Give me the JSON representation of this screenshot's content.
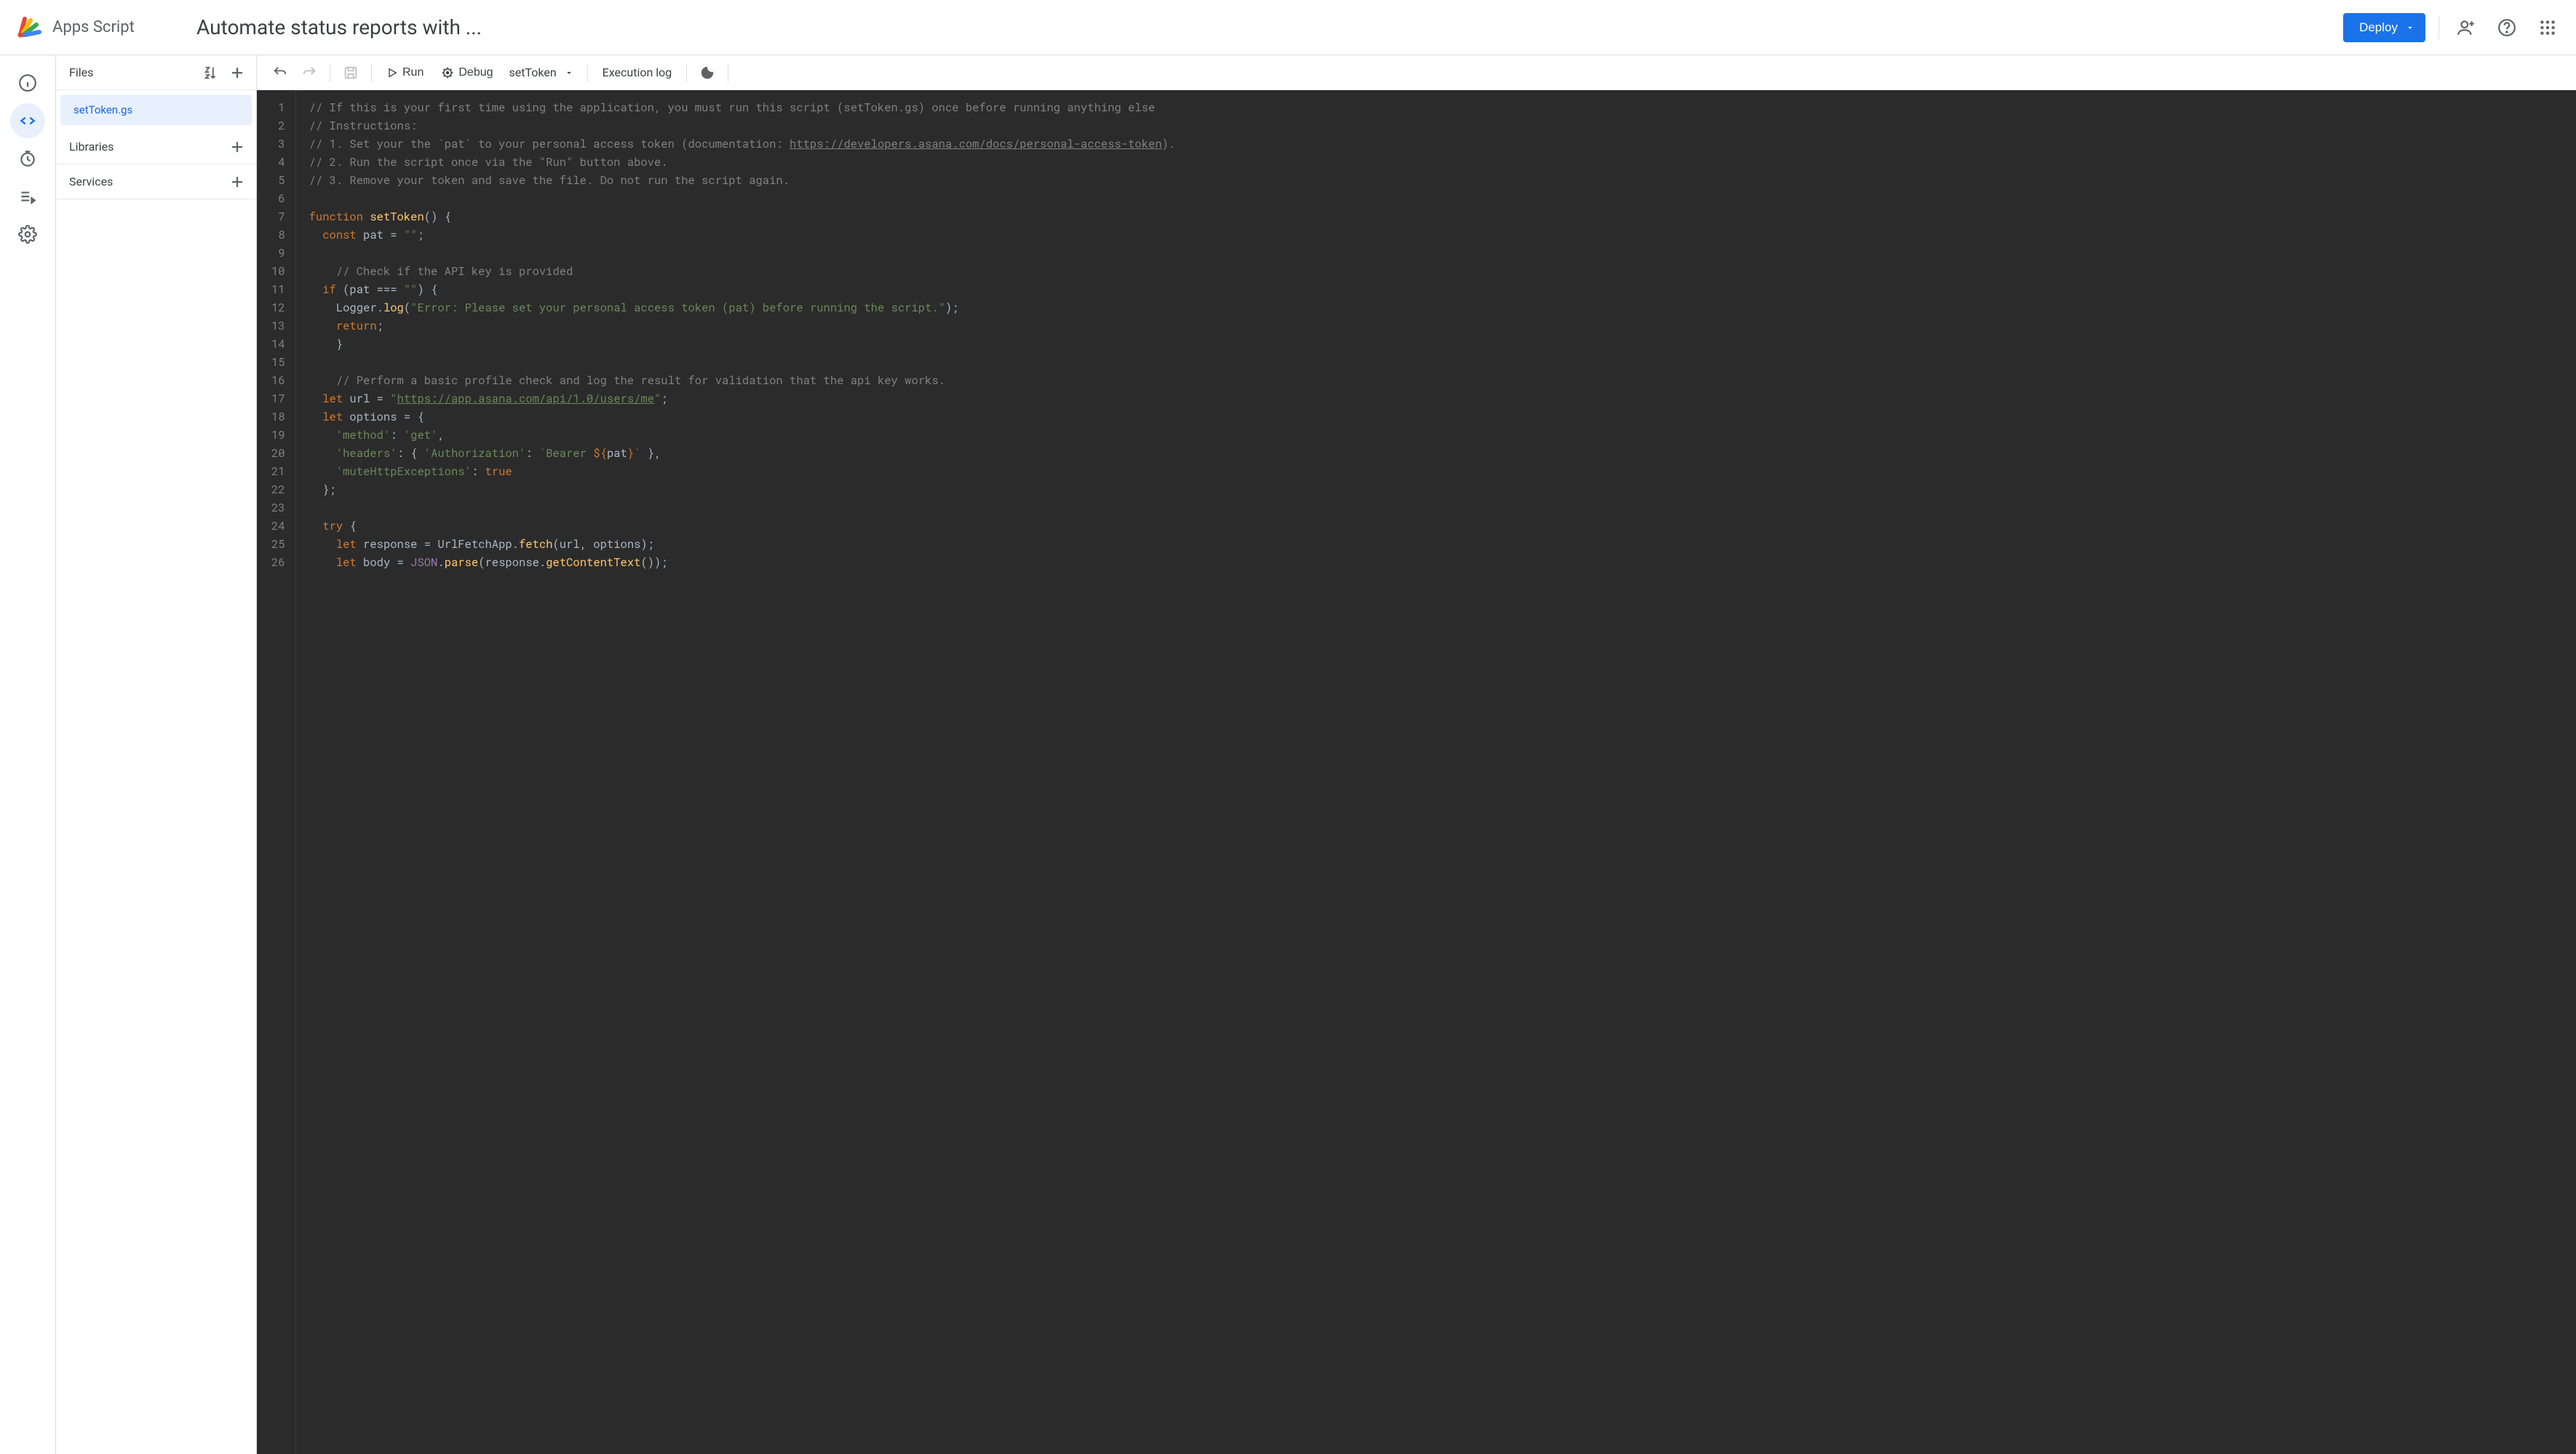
{
  "header": {
    "product_name": "Apps Script",
    "project_title": "Automate status reports with ...",
    "deploy_label": "Deploy"
  },
  "nav": {
    "items": [
      "overview",
      "editor",
      "triggers",
      "executions",
      "settings"
    ],
    "active_index": 1
  },
  "file_panel": {
    "files_label": "Files",
    "libraries_label": "Libraries",
    "services_label": "Services",
    "files": [
      {
        "name": "setToken.gs",
        "selected": true
      }
    ]
  },
  "toolbar": {
    "run_label": "Run",
    "debug_label": "Debug",
    "function_selected": "setToken",
    "exec_log_label": "Execution log"
  },
  "code": {
    "url_doc": "https://developers.asana.com/docs/personal-access-token",
    "api_url": "https://app.asana.com/api/1.0/users/me",
    "lines": [
      {
        "n": 1,
        "type": "comment",
        "text": "// If this is your first time using the application, you must run this script (setToken.gs) once before running anything else"
      },
      {
        "n": 2,
        "type": "comment",
        "text": "// Instructions:"
      },
      {
        "n": 3,
        "type": "comment-url",
        "prefix": "// 1. Set your the `pat` to your personal access token (documentation: ",
        "url": "https://developers.asana.com/docs/personal-access-token",
        "suffix": ")."
      },
      {
        "n": 4,
        "type": "comment",
        "text": "// 2. Run the script once via the \"Run\" button above."
      },
      {
        "n": 5,
        "type": "comment",
        "text": "// 3. Remove your token and save the file. Do not run the script again."
      },
      {
        "n": 6,
        "type": "blank"
      },
      {
        "n": 7,
        "type": "fn-def"
      },
      {
        "n": 8,
        "type": "const-pat"
      },
      {
        "n": 9,
        "type": "blank"
      },
      {
        "n": 10,
        "type": "comment",
        "indent": 2,
        "text": "// Check if the API key is provided"
      },
      {
        "n": 11,
        "type": "if-pat"
      },
      {
        "n": 12,
        "type": "logger-error",
        "msg": "\"Error: Please set your personal access token (pat) before running the script.\""
      },
      {
        "n": 13,
        "type": "return"
      },
      {
        "n": 14,
        "type": "close-brace",
        "indent": 2
      },
      {
        "n": 15,
        "type": "blank"
      },
      {
        "n": 16,
        "type": "comment",
        "indent": 2,
        "text": "// Perform a basic profile check and log the result for validation that the api key works."
      },
      {
        "n": 17,
        "type": "let-url"
      },
      {
        "n": 18,
        "type": "let-options"
      },
      {
        "n": 19,
        "type": "opt-method"
      },
      {
        "n": 20,
        "type": "opt-headers"
      },
      {
        "n": 21,
        "type": "opt-mute"
      },
      {
        "n": 22,
        "type": "close-options"
      },
      {
        "n": 23,
        "type": "blank"
      },
      {
        "n": 24,
        "type": "try"
      },
      {
        "n": 25,
        "type": "fetch"
      },
      {
        "n": 26,
        "type": "parse"
      }
    ]
  }
}
